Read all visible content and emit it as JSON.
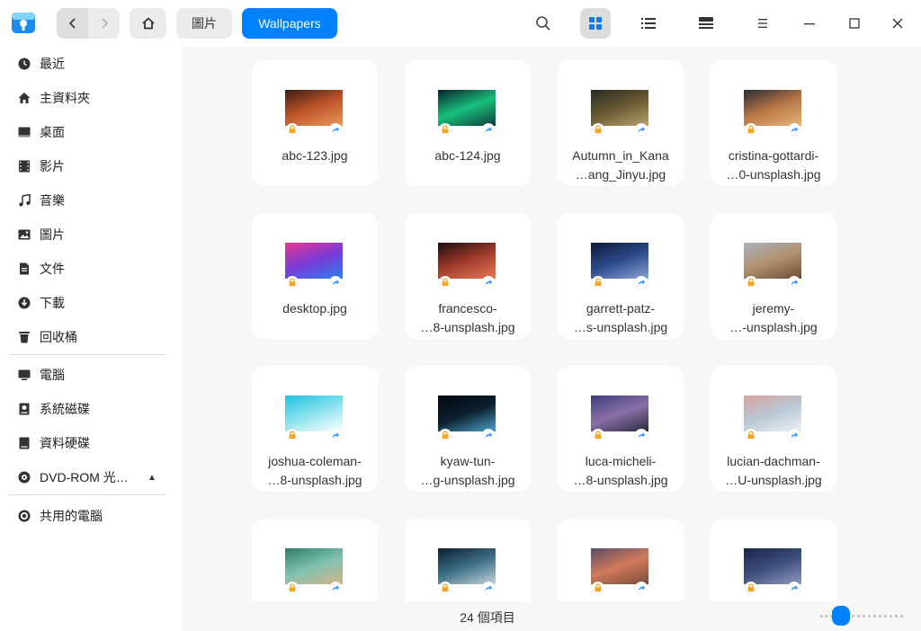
{
  "toolbar": {
    "breadcrumb": [
      {
        "label": "圖片"
      },
      {
        "label": "Wallpapers"
      }
    ]
  },
  "sidebar": {
    "items": [
      {
        "label": "最近",
        "icon": "clock-icon"
      },
      {
        "label": "主資料夾",
        "icon": "home-icon"
      },
      {
        "label": "桌面",
        "icon": "desktop-icon"
      },
      {
        "label": "影片",
        "icon": "video-icon"
      },
      {
        "label": "音樂",
        "icon": "music-icon"
      },
      {
        "label": "圖片",
        "icon": "picture-icon"
      },
      {
        "label": "文件",
        "icon": "document-icon"
      },
      {
        "label": "下載",
        "icon": "download-icon"
      },
      {
        "label": "回收桶",
        "icon": "trash-icon"
      },
      {
        "label": "電腦",
        "icon": "computer-icon"
      },
      {
        "label": "系統磁碟",
        "icon": "system-disk-icon"
      },
      {
        "label": "資料硬碟",
        "icon": "data-disk-icon"
      },
      {
        "label": "DVD-ROM 光…",
        "icon": "dvd-icon"
      },
      {
        "label": "共用的電腦",
        "icon": "network-icon"
      }
    ]
  },
  "files": [
    {
      "line1": "abc-123.jpg",
      "line2": "",
      "colors": [
        "#3a1e16",
        "#c0552a",
        "#e49a5c"
      ]
    },
    {
      "line1": "abc-124.jpg",
      "line2": "",
      "colors": [
        "#06222a",
        "#19c07d",
        "#0b3b3a"
      ]
    },
    {
      "line1": "Autumn_in_Kana",
      "line2": "…ang_Jinyu.jpg",
      "colors": [
        "#2a2a22",
        "#6b5a33",
        "#b9a36a"
      ]
    },
    {
      "line1": "cristina-gottardi-",
      "line2": "…0-unsplash.jpg",
      "colors": [
        "#2b2a33",
        "#b97845",
        "#e8b27a"
      ]
    },
    {
      "line1": "desktop.jpg",
      "line2": "",
      "colors": [
        "#e53a8f",
        "#7a3ad8",
        "#2d7ff0"
      ]
    },
    {
      "line1": "francesco-",
      "line2": "…8-unsplash.jpg",
      "colors": [
        "#1d0e0e",
        "#a03a2c",
        "#e77b55"
      ]
    },
    {
      "line1": "garrett-patz-",
      "line2": "…s-unsplash.jpg",
      "colors": [
        "#0e1a3a",
        "#2b4a8a",
        "#8aa4d4"
      ]
    },
    {
      "line1": "jeremy-",
      "line2": "…-unsplash.jpg",
      "colors": [
        "#a9b3bd",
        "#b1916e",
        "#6e4c34"
      ]
    },
    {
      "line1": "joshua-coleman-",
      "line2": "…8-unsplash.jpg",
      "colors": [
        "#1fc2dc",
        "#8ce2ee",
        "#ffffff"
      ]
    },
    {
      "line1": "kyaw-tun-",
      "line2": "…g-unsplash.jpg",
      "colors": [
        "#02080f",
        "#0b1f2e",
        "#4aa3c8"
      ]
    },
    {
      "line1": "luca-micheli-",
      "line2": "…8-unsplash.jpg",
      "colors": [
        "#3a3f7a",
        "#8b6fa8",
        "#2b2b3b"
      ]
    },
    {
      "line1": "lucian-dachman-",
      "line2": "…U-unsplash.jpg",
      "colors": [
        "#d7a39c",
        "#b9c7d5",
        "#eef2f6"
      ]
    },
    {
      "line1": "",
      "line2": "",
      "colors": [
        "#2f7c6a",
        "#7fc2b0",
        "#d3b58a"
      ]
    },
    {
      "line1": "",
      "line2": "",
      "colors": [
        "#0f2030",
        "#3c6f87",
        "#c4d4d8"
      ]
    },
    {
      "line1": "",
      "line2": "",
      "colors": [
        "#5c4a6a",
        "#d07a5a",
        "#7a4a3a"
      ]
    },
    {
      "line1": "",
      "line2": "",
      "colors": [
        "#1a2448",
        "#3d4f7e",
        "#8e9cc2"
      ]
    }
  ],
  "status": {
    "item_count": "24 個項目"
  },
  "icon_size_slider": {
    "value": 0.18
  },
  "colors": {
    "accent": "#0081ff",
    "lock_badge": "#f5a623",
    "link_badge": "#2f8fff"
  }
}
